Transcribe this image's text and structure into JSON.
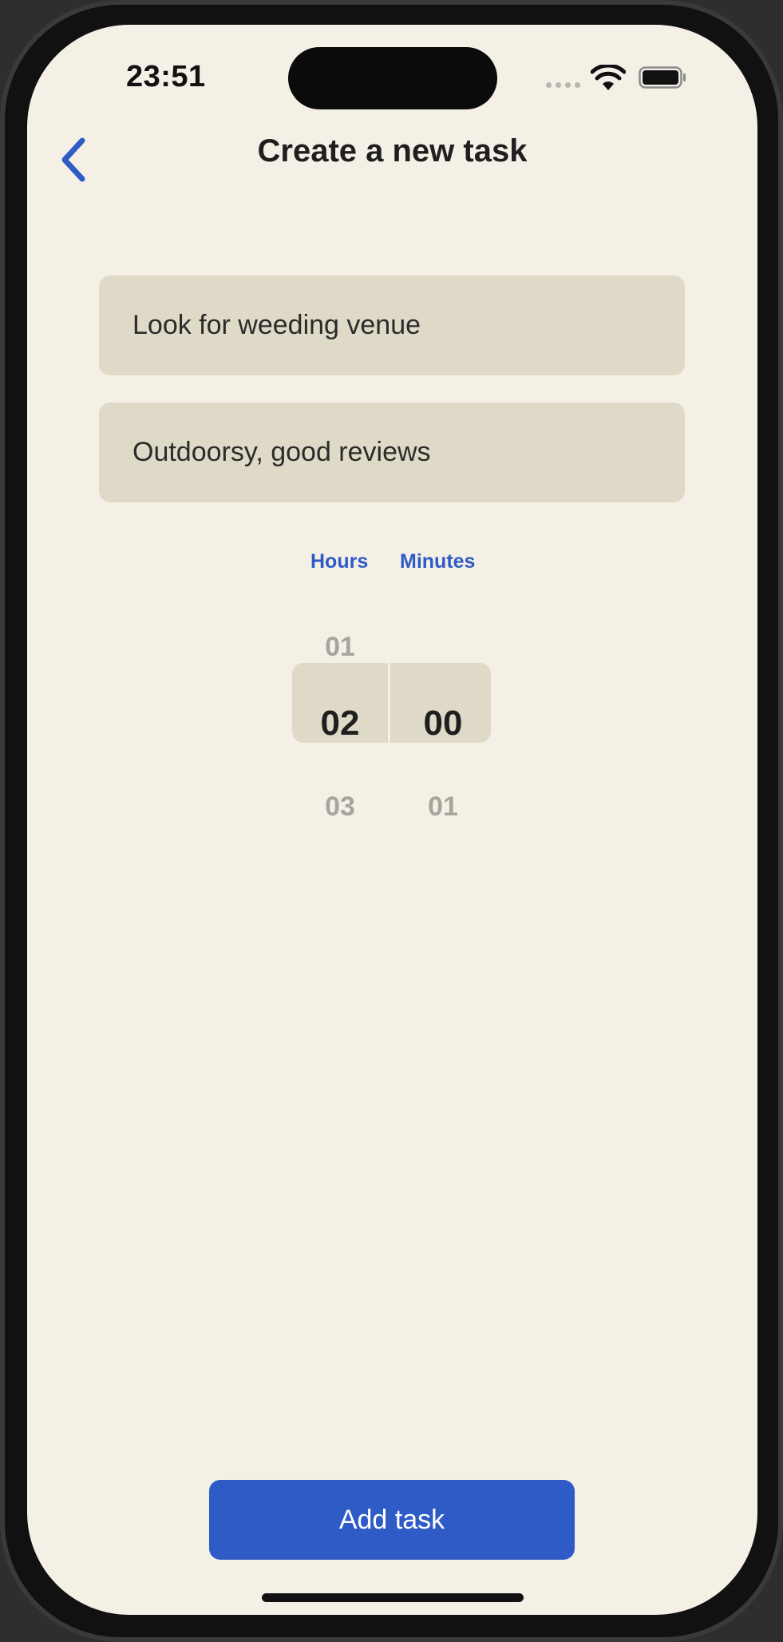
{
  "status_bar": {
    "time": "23:51",
    "wifi_icon": "wifi-icon",
    "battery_icon": "battery-icon"
  },
  "nav": {
    "back_icon": "chevron-left-icon",
    "title": "Create a new task"
  },
  "form": {
    "task_name_value": "Look for weeding venue",
    "task_notes_value": "Outdoorsy, good reviews"
  },
  "duration_picker": {
    "hours_label": "Hours",
    "minutes_label": "Minutes",
    "hours": {
      "previous": "01",
      "selected": "02",
      "next": "03"
    },
    "minutes": {
      "previous": "",
      "selected": "00",
      "next": "01"
    }
  },
  "actions": {
    "add_task_label": "Add task"
  },
  "colors": {
    "accent": "#2f5bc7",
    "background": "#f4f0e6",
    "field": "#dfdac7"
  }
}
